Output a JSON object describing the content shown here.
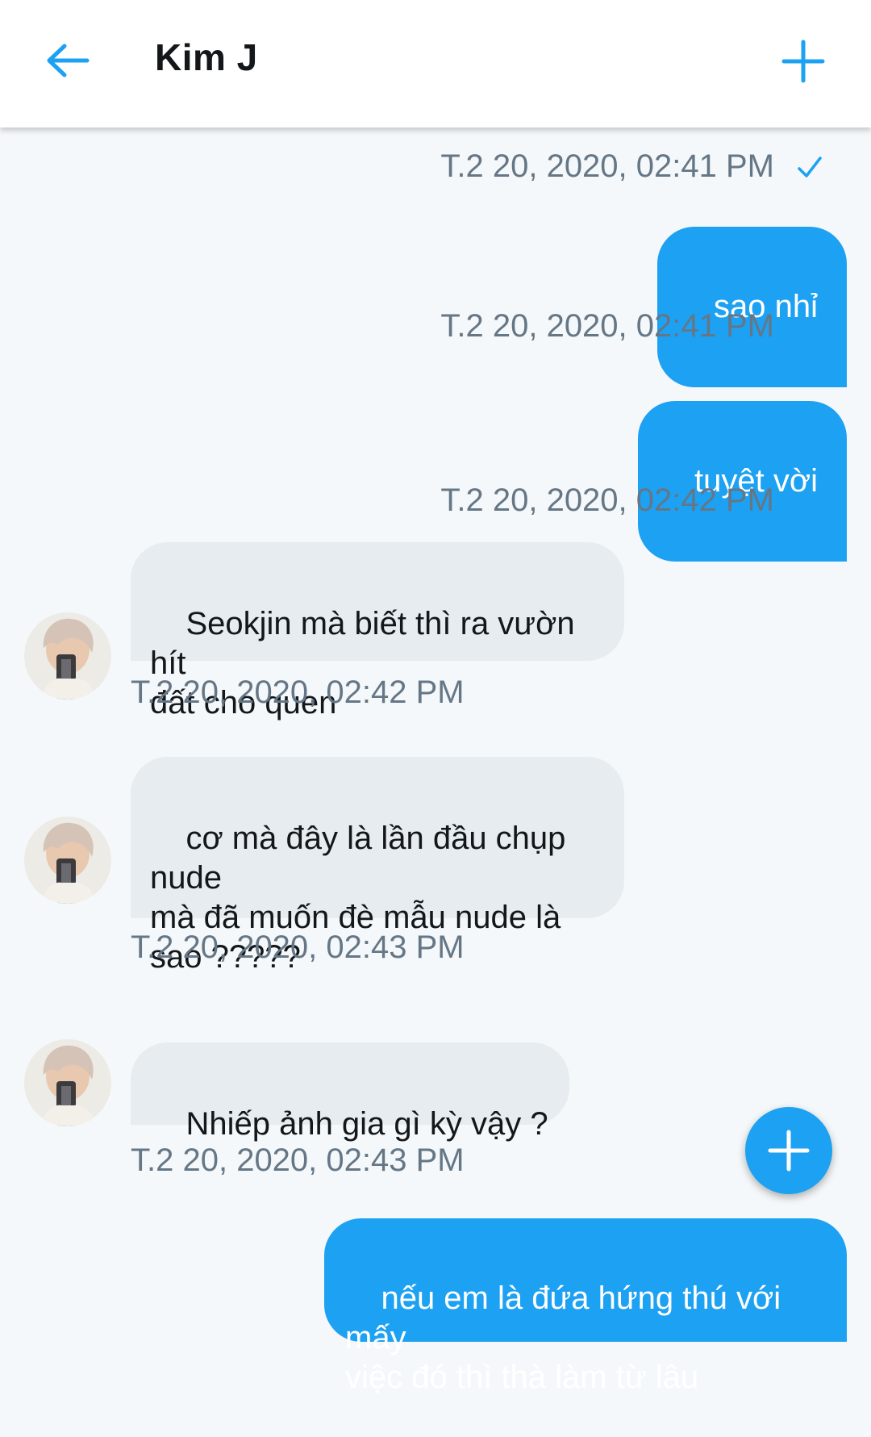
{
  "header": {
    "title": "Kim J",
    "back_icon": "arrow-left-icon",
    "add_icon": "plus-icon"
  },
  "colors": {
    "accent": "#1da1f2",
    "incoming_bubble": "#e6ecf0",
    "timestamp": "#657786",
    "background": "#f5f8fa"
  },
  "messages": [
    {
      "direction": "out",
      "timestamp": "T.2 20, 2020, 02:41 PM",
      "status_icon": "check-icon"
    },
    {
      "direction": "out",
      "text": "sao nhỉ",
      "timestamp": "T.2 20, 2020, 02:41 PM",
      "status_icon": "check-icon"
    },
    {
      "direction": "out",
      "text": "tuyệt vời",
      "timestamp": "T.2 20, 2020, 02:42 PM",
      "status_icon": "check-icon"
    },
    {
      "direction": "in",
      "text": "Seokjin mà biết thì ra vườn hít\nđất cho quen",
      "emoji": "🤨",
      "timestamp": "T.2 20, 2020, 02:42 PM"
    },
    {
      "direction": "in",
      "text": "cơ mà đây là lần đầu chụp nude\nmà đã muốn đè mẫu nude là\nsao ?????",
      "timestamp": "T.2 20, 2020, 02:43 PM"
    },
    {
      "direction": "in",
      "text": "Nhiếp ảnh gia gì kỳ vậy ?",
      "timestamp": "T.2 20, 2020, 02:43 PM"
    },
    {
      "direction": "out",
      "text": "nếu em là đứa hứng thú với mấy\nviệc đó thì thà làm từ lâu"
    }
  ],
  "fab": {
    "icon": "plus-icon"
  }
}
